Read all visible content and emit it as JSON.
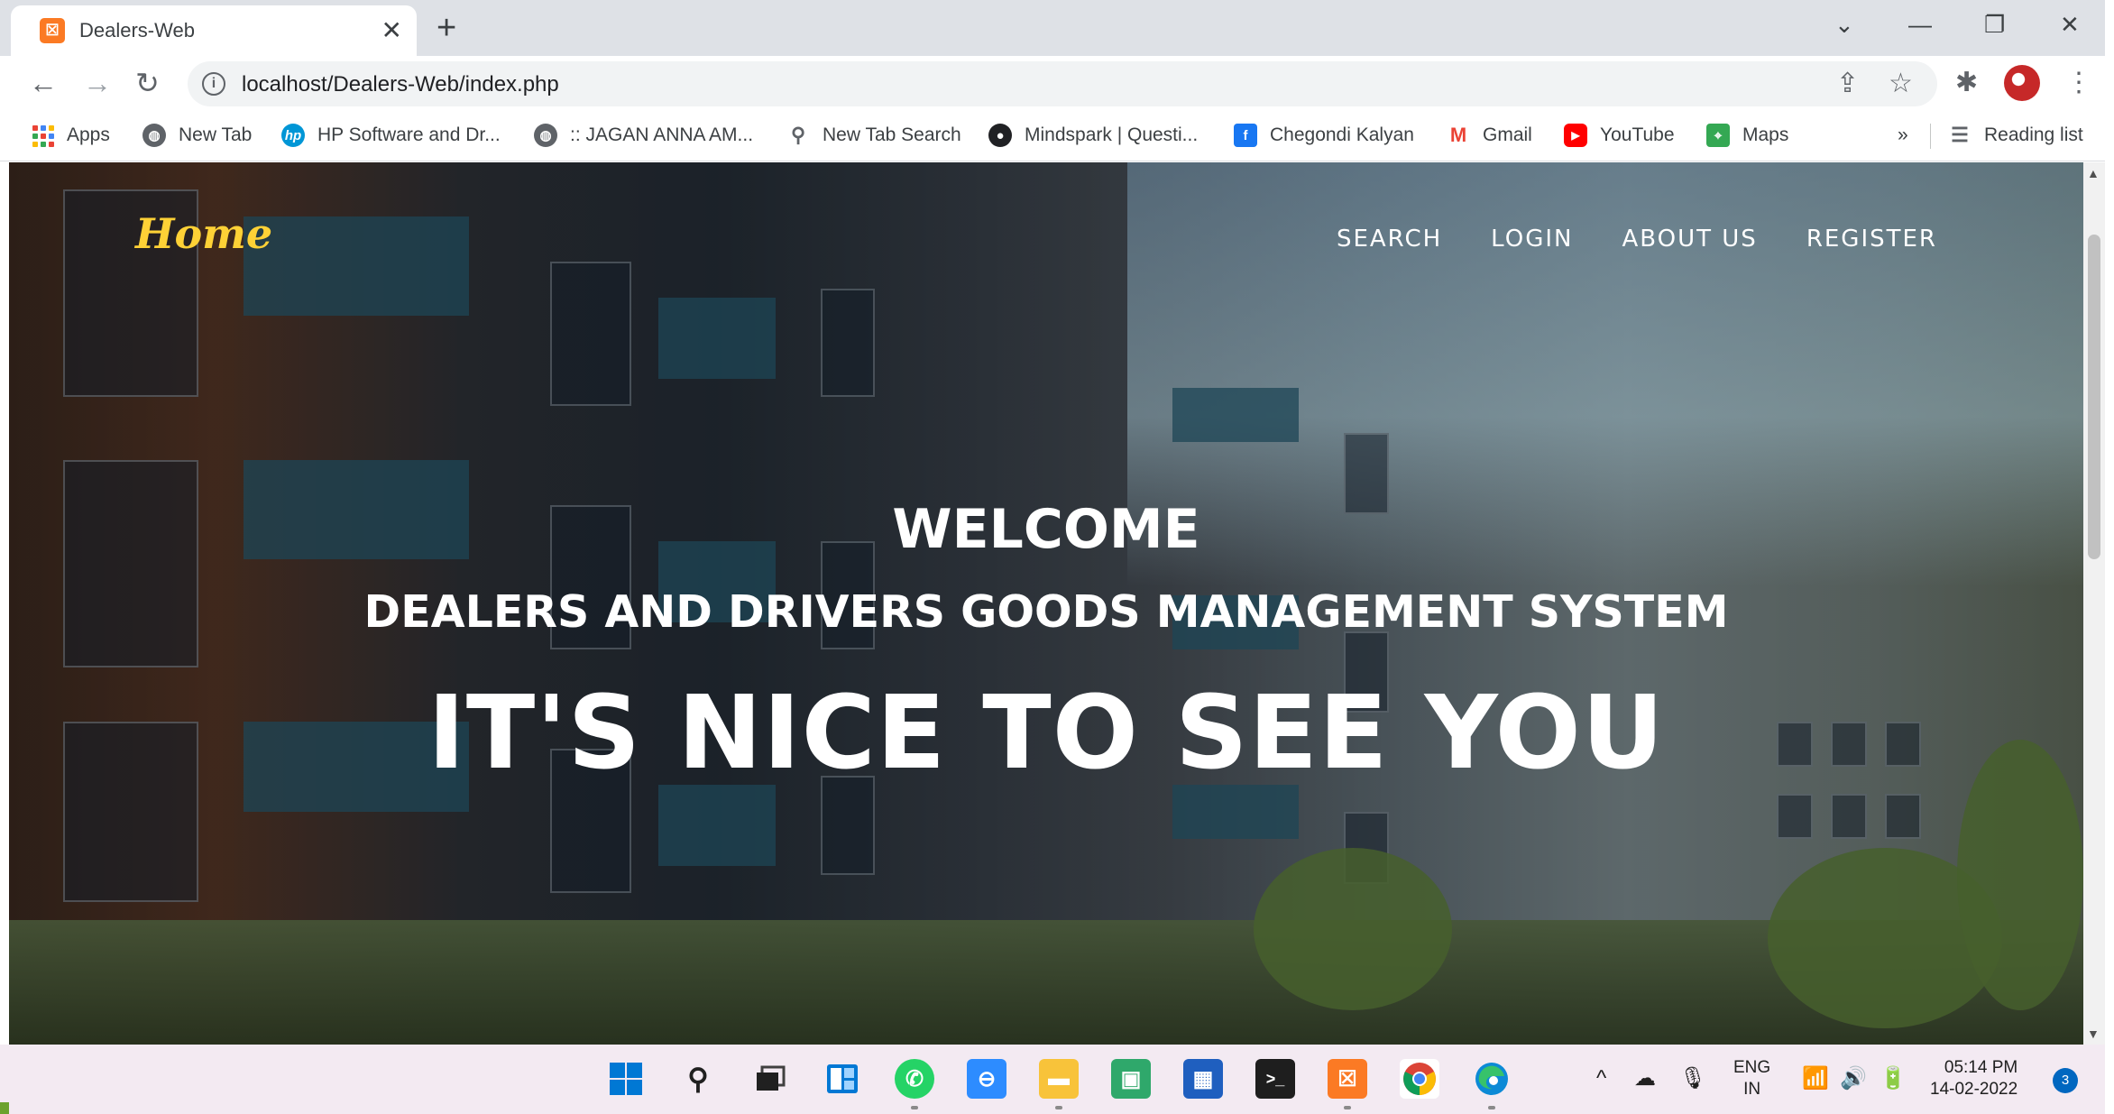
{
  "browser": {
    "tab": {
      "title": "Dealers-Web",
      "close_glyph": "✕"
    },
    "new_tab_glyph": "+",
    "window_controls": {
      "chevron": "⌄",
      "minimize": "—",
      "restore": "❐",
      "close": "✕"
    },
    "nav": {
      "back": "←",
      "forward": "→",
      "reload": "↻"
    },
    "address_bar": {
      "url": "localhost/Dealers-Web/index.php",
      "info_glyph": "i"
    },
    "toolbar_icons": {
      "share": "⇪",
      "bookmark_star": "☆",
      "extensions": "✱",
      "menu": "⋮"
    },
    "bookmarks": [
      {
        "label": "Apps",
        "icon": "apps-grid-icon"
      },
      {
        "label": "New Tab",
        "icon": "globe-icon"
      },
      {
        "label": "HP Software and Dr...",
        "icon": "hp-logo-icon"
      },
      {
        "label": ":: JAGAN ANNA AM...",
        "icon": "globe-icon"
      },
      {
        "label": "New Tab Search",
        "icon": "search-icon"
      },
      {
        "label": "Mindspark | Questi...",
        "icon": "mindspark-icon"
      },
      {
        "label": "Chegondi Kalyan",
        "icon": "facebook-icon"
      },
      {
        "label": "Gmail",
        "icon": "gmail-icon"
      },
      {
        "label": "YouTube",
        "icon": "youtube-icon"
      },
      {
        "label": "Maps",
        "icon": "maps-icon"
      }
    ],
    "bookmarks_overflow": "»",
    "reading_list": "Reading list"
  },
  "page": {
    "brand": "Home",
    "nav_links": [
      "SEARCH",
      "LOGIN",
      "ABOUT US",
      "REGISTER"
    ],
    "hero": {
      "lead": "WELCOME",
      "subheading": "DEALERS AND DRIVERS GOODS MANAGEMENT SYSTEM",
      "heading": "IT'S NICE TO SEE YOU"
    }
  },
  "scrollbar": {
    "up": "▲",
    "down": "▼"
  },
  "taskbar": {
    "apps": [
      {
        "name": "windows-start-icon"
      },
      {
        "name": "search-icon"
      },
      {
        "name": "task-view-icon"
      },
      {
        "name": "widgets-icon"
      },
      {
        "name": "whatsapp-icon"
      },
      {
        "name": "zoom-icon"
      },
      {
        "name": "file-explorer-icon"
      },
      {
        "name": "photos-icon"
      },
      {
        "name": "microsoft-store-icon"
      },
      {
        "name": "terminal-icon"
      },
      {
        "name": "xampp-icon"
      },
      {
        "name": "chrome-icon"
      },
      {
        "name": "edge-icon"
      }
    ],
    "tray": {
      "chevron": "^",
      "cloud": "☁",
      "mic": "🎙",
      "wifi": "📶",
      "volume": "🔊",
      "battery": "🔋"
    },
    "language": {
      "line1": "ENG",
      "line2": "IN"
    },
    "time": "05:14 PM",
    "date": "14-02-2022",
    "notification_count": "3"
  }
}
